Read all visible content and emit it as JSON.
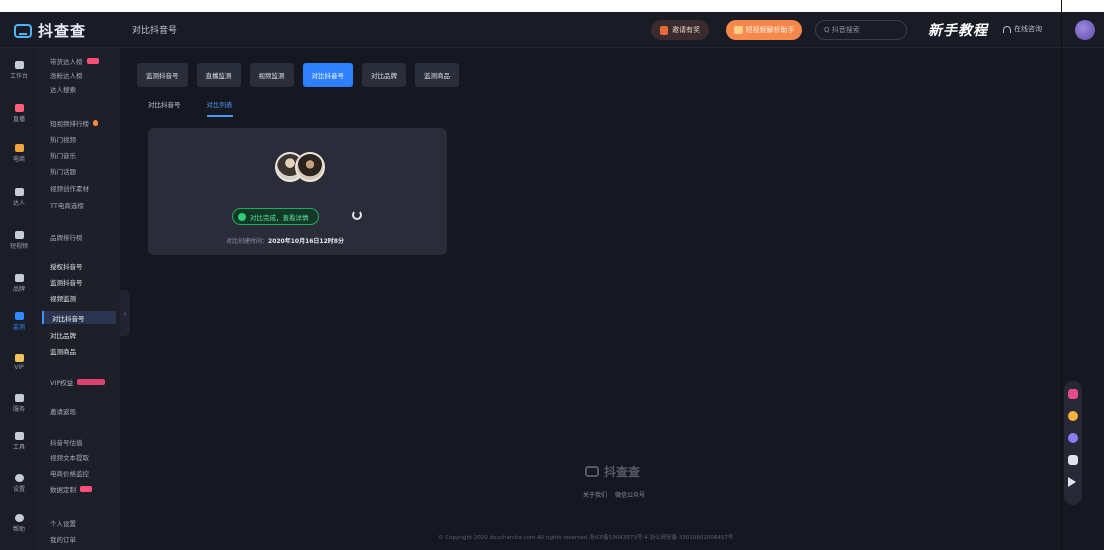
{
  "app": {
    "logo_text": "抖查查",
    "page_name": "对比抖音号"
  },
  "header": {
    "promo_label": "邀请有奖",
    "upgrade_label": "短视频解析助手",
    "search_placeholder": "Q 抖音搜索",
    "tutorial_label": "新手教程",
    "service_label": "在线咨询"
  },
  "rail": [
    {
      "label": "工作台",
      "icon": "grid-icon"
    },
    {
      "label": "直播",
      "icon": "live-icon"
    },
    {
      "label": "电商",
      "icon": "shop-icon"
    },
    {
      "label": "达人",
      "icon": "tiktok-icon"
    },
    {
      "label": "短视频",
      "icon": "video-icon"
    },
    {
      "label": "品牌",
      "icon": "brand-icon"
    },
    {
      "label": "监测",
      "icon": "monitor-icon"
    },
    {
      "label": "VIP",
      "icon": "crown-icon"
    },
    {
      "label": "服务",
      "icon": "service-icon"
    },
    {
      "label": "工具",
      "icon": "tool-icon"
    },
    {
      "label": "设置",
      "icon": "settings-icon"
    },
    {
      "label": "帮助",
      "icon": "help-icon"
    }
  ],
  "submenu": [
    {
      "label": "带货达人榜",
      "badge": true
    },
    {
      "label": "涨粉达人榜"
    },
    {
      "label": "达人搜索"
    },
    {
      "label": "短视频排行榜",
      "fire": true
    },
    {
      "label": "热门视频"
    },
    {
      "label": "热门音乐"
    },
    {
      "label": "热门话题"
    },
    {
      "label": "视频创作素材"
    },
    {
      "label": "TT电商选榜"
    },
    {
      "label": "品牌排行榜"
    },
    {
      "label": "授权抖音号"
    },
    {
      "label": "监测抖音号"
    },
    {
      "label": "视频监测"
    },
    {
      "label": "对比抖音号"
    },
    {
      "label": "对比品牌"
    },
    {
      "label": "监测商品"
    },
    {
      "label": "VIP权益",
      "badge_wide": true
    },
    {
      "label": "邀请返现"
    },
    {
      "label": "抖音号估值"
    },
    {
      "label": "视频文本提取"
    },
    {
      "label": "电商价格监控"
    },
    {
      "label": "数据定制",
      "badge": true
    },
    {
      "label": "个人设置"
    },
    {
      "label": "我的订单"
    }
  ],
  "tabs": [
    {
      "label": "监测抖音号"
    },
    {
      "label": "直播监测"
    },
    {
      "label": "视频监测"
    },
    {
      "label": "对比抖音号"
    },
    {
      "label": "对比品牌"
    },
    {
      "label": "监测商品"
    }
  ],
  "subtabs": [
    {
      "label": "对比抖音号"
    },
    {
      "label": "对比列表"
    }
  ],
  "card": {
    "status_label": "对比完成，查看详情",
    "update_label": "对比创建时间：",
    "update_time": "2020年10月16日12时8分"
  },
  "footer": {
    "logo_text": "抖查查",
    "links": [
      "关于我们",
      "微信公众号"
    ],
    "copyright": "© Copyright 2020 doucharcha.com All rights reserved 浙ICP备19043973号-4 浙公网安备 33010802008457号"
  },
  "colors": {
    "accent": "#2f80ff",
    "success": "#2fcf78",
    "background": "#161821",
    "upgrade": "#f7884c"
  }
}
